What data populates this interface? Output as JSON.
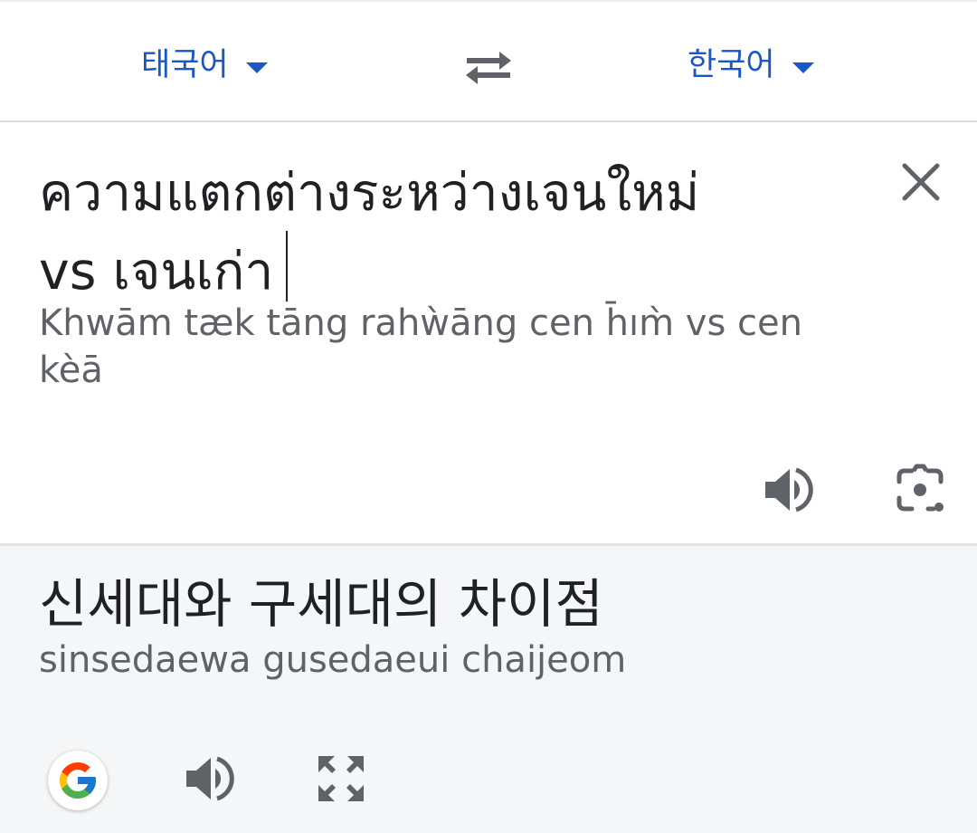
{
  "lang_bar": {
    "source_lang": "태국어",
    "target_lang": "한국어",
    "accent_color": "#1a56c5",
    "swap_icon": "swap-arrows-icon",
    "dropdown_icon": "caret-down-icon"
  },
  "source": {
    "text_line1": "ความแตกต่างระหว่างเจนใหม่",
    "text_line2": "vs เจนเก่า",
    "transliteration_line1": "Khwām tæk tāng rahẁāng cen h̄ım̀ vs cen",
    "transliteration_line2": "kèā",
    "icons": [
      "close-icon",
      "speaker-icon",
      "camera-lens-icon"
    ]
  },
  "result": {
    "text": "신세대와 구세대의 차이점",
    "transliteration": "sinsedaewa gusedaeui chaijeom",
    "background_color": "#f5f6f8",
    "icons": [
      "google-logo-icon",
      "speaker-icon",
      "fullscreen-icon"
    ]
  }
}
